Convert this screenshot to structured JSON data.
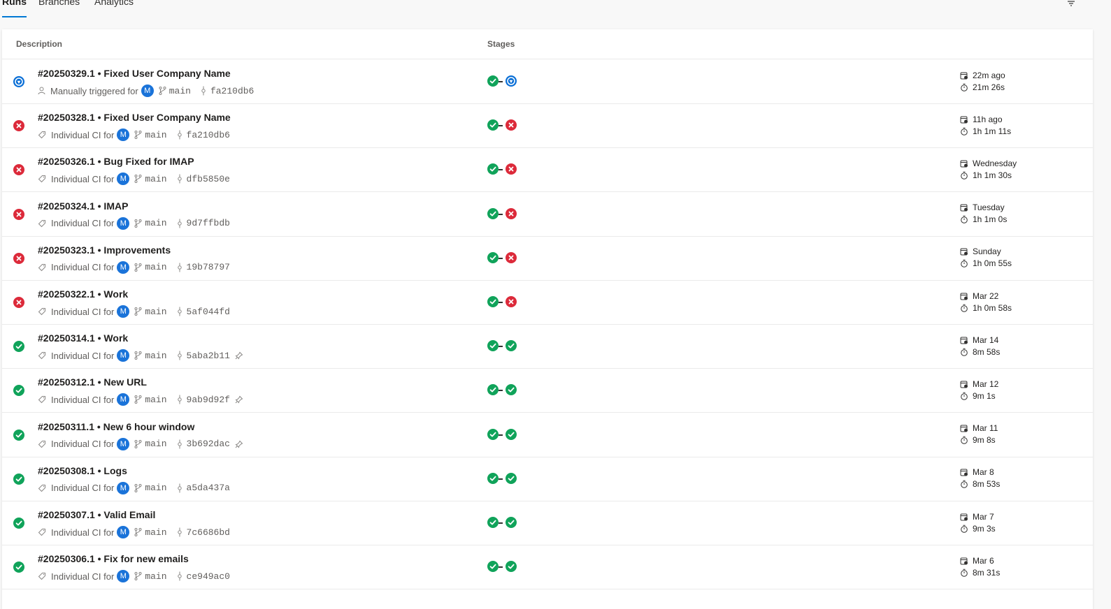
{
  "tabs": [
    {
      "label": "Runs",
      "active": true
    },
    {
      "label": "Branches",
      "active": false
    },
    {
      "label": "Analytics",
      "active": false
    }
  ],
  "columns": {
    "description": "Description",
    "stages": "Stages"
  },
  "colors": {
    "accent": "#0078d4",
    "success": "#10a35a",
    "failed": "#dc2a3a",
    "running": "#0a6fd6",
    "avatar": "#1a73d9"
  },
  "runs": [
    {
      "title": "#20250329.1 • Fixed User Company Name",
      "status": "running",
      "trigger": "Manually triggered for",
      "trigger_icon": "person-icon",
      "avatar": "M",
      "branch": "main",
      "commit": "fa210db6",
      "pinned": false,
      "stages": [
        "success",
        "running"
      ],
      "when": "22m ago",
      "duration": "21m 26s"
    },
    {
      "title": "#20250328.1 • Fixed User Company Name",
      "status": "failed",
      "trigger": "Individual CI for",
      "trigger_icon": "tag-icon",
      "avatar": "M",
      "branch": "main",
      "commit": "fa210db6",
      "pinned": false,
      "stages": [
        "success",
        "failed"
      ],
      "when": "11h ago",
      "duration": "1h 1m 11s"
    },
    {
      "title": "#20250326.1 • Bug Fixed for IMAP",
      "status": "failed",
      "trigger": "Individual CI for",
      "trigger_icon": "tag-icon",
      "avatar": "M",
      "branch": "main",
      "commit": "dfb5850e",
      "pinned": false,
      "stages": [
        "success",
        "failed"
      ],
      "when": "Wednesday",
      "duration": "1h 1m 30s"
    },
    {
      "title": "#20250324.1 • IMAP",
      "status": "failed",
      "trigger": "Individual CI for",
      "trigger_icon": "tag-icon",
      "avatar": "M",
      "branch": "main",
      "commit": "9d7ffbdb",
      "pinned": false,
      "stages": [
        "success",
        "failed"
      ],
      "when": "Tuesday",
      "duration": "1h 1m 0s"
    },
    {
      "title": "#20250323.1 • Improvements",
      "status": "failed",
      "trigger": "Individual CI for",
      "trigger_icon": "tag-icon",
      "avatar": "M",
      "branch": "main",
      "commit": "19b78797",
      "pinned": false,
      "stages": [
        "success",
        "failed"
      ],
      "when": "Sunday",
      "duration": "1h 0m 55s"
    },
    {
      "title": "#20250322.1 • Work",
      "status": "failed",
      "trigger": "Individual CI for",
      "trigger_icon": "tag-icon",
      "avatar": "M",
      "branch": "main",
      "commit": "5af044fd",
      "pinned": false,
      "stages": [
        "success",
        "failed"
      ],
      "when": "Mar 22",
      "duration": "1h 0m 58s"
    },
    {
      "title": "#20250314.1 • Work",
      "status": "success",
      "trigger": "Individual CI for",
      "trigger_icon": "tag-icon",
      "avatar": "M",
      "branch": "main",
      "commit": "5aba2b11",
      "pinned": true,
      "stages": [
        "success",
        "success"
      ],
      "when": "Mar 14",
      "duration": "8m 58s"
    },
    {
      "title": "#20250312.1 • New URL",
      "status": "success",
      "trigger": "Individual CI for",
      "trigger_icon": "tag-icon",
      "avatar": "M",
      "branch": "main",
      "commit": "9ab9d92f",
      "pinned": true,
      "stages": [
        "success",
        "success"
      ],
      "when": "Mar 12",
      "duration": "9m 1s"
    },
    {
      "title": "#20250311.1 • New 6 hour window",
      "status": "success",
      "trigger": "Individual CI for",
      "trigger_icon": "tag-icon",
      "avatar": "M",
      "branch": "main",
      "commit": "3b692dac",
      "pinned": true,
      "stages": [
        "success",
        "success"
      ],
      "when": "Mar 11",
      "duration": "9m 8s"
    },
    {
      "title": "#20250308.1 • Logs",
      "status": "success",
      "trigger": "Individual CI for",
      "trigger_icon": "tag-icon",
      "avatar": "M",
      "branch": "main",
      "commit": "a5da437a",
      "pinned": false,
      "stages": [
        "success",
        "success"
      ],
      "when": "Mar 8",
      "duration": "8m 53s"
    },
    {
      "title": "#20250307.1 • Valid Email",
      "status": "success",
      "trigger": "Individual CI for",
      "trigger_icon": "tag-icon",
      "avatar": "M",
      "branch": "main",
      "commit": "7c6686bd",
      "pinned": false,
      "stages": [
        "success",
        "success"
      ],
      "when": "Mar 7",
      "duration": "9m 3s"
    },
    {
      "title": "#20250306.1 • Fix for new emails",
      "status": "success",
      "trigger": "Individual CI for",
      "trigger_icon": "tag-icon",
      "avatar": "M",
      "branch": "main",
      "commit": "ce949ac0",
      "pinned": false,
      "stages": [
        "success",
        "success"
      ],
      "when": "Mar 6",
      "duration": "8m 31s"
    }
  ]
}
